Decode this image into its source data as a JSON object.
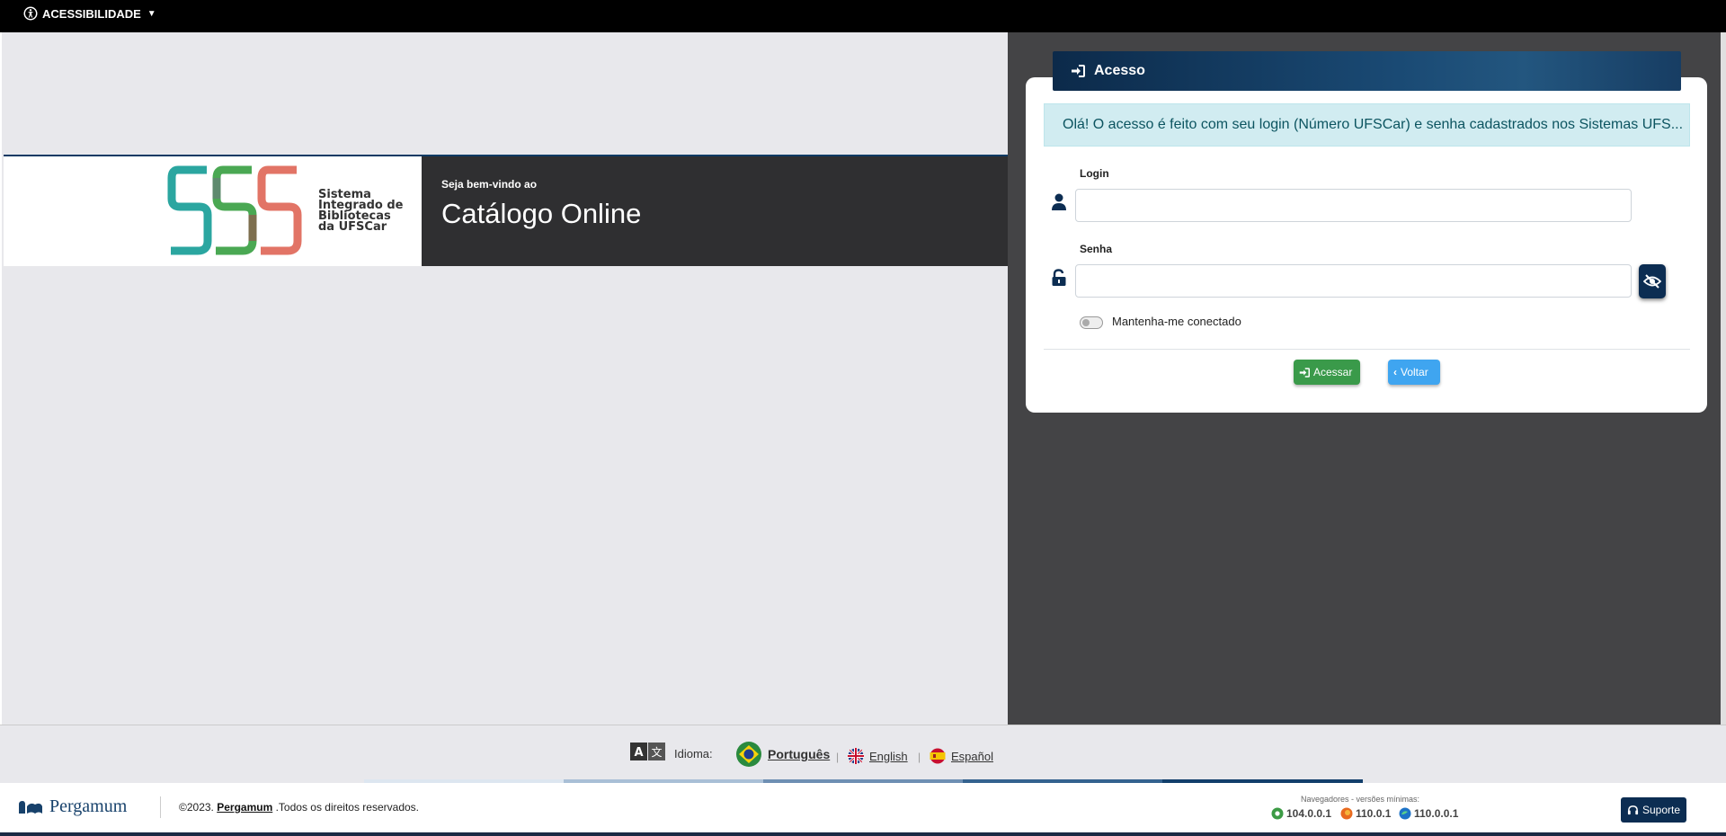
{
  "topbar": {
    "accessibility_label": "ACESSIBILIDADE"
  },
  "hero": {
    "logo_lines": [
      "Sistema",
      "Integrado de",
      "Bibliotecas",
      "da UFSCar"
    ],
    "welcome": "Seja bem-vindo ao",
    "title": "Catálogo Online"
  },
  "login": {
    "header": "Acesso",
    "alert": "Olá! O acesso é feito com seu login (Número UFSCar) e senha cadastrados nos Sistemas UFS...",
    "login_label": "Login",
    "login_value": "",
    "password_label": "Senha",
    "password_value": "",
    "remember_label": "Mantenha-me conectado",
    "remember_checked": false,
    "submit_label": "Acessar",
    "back_label": "Voltar",
    "colors": {
      "submit": "#3a9a4a",
      "back": "#3fa5f0",
      "header": "#0c2a4a"
    }
  },
  "language": {
    "label": "Idioma:",
    "options": [
      "Português",
      "English",
      "Español"
    ],
    "selected": "Português",
    "icons": [
      "flag-brazil-icon",
      "flag-uk-icon",
      "flag-spain-icon"
    ]
  },
  "footer": {
    "brand": "Pergamum",
    "copyright_prefix": "©2023.",
    "copyright_link": "Pergamum",
    "copyright_suffix": ".Todos os direitos reservados.",
    "browsers_title": "Navegadores - versões mínimas:",
    "browsers": [
      {
        "name": "chrome-icon",
        "version": "104.0.0.1"
      },
      {
        "name": "firefox-icon",
        "version": "110.0.1"
      },
      {
        "name": "edge-icon",
        "version": "110.0.0.1"
      }
    ],
    "support_label": "Suporte"
  }
}
